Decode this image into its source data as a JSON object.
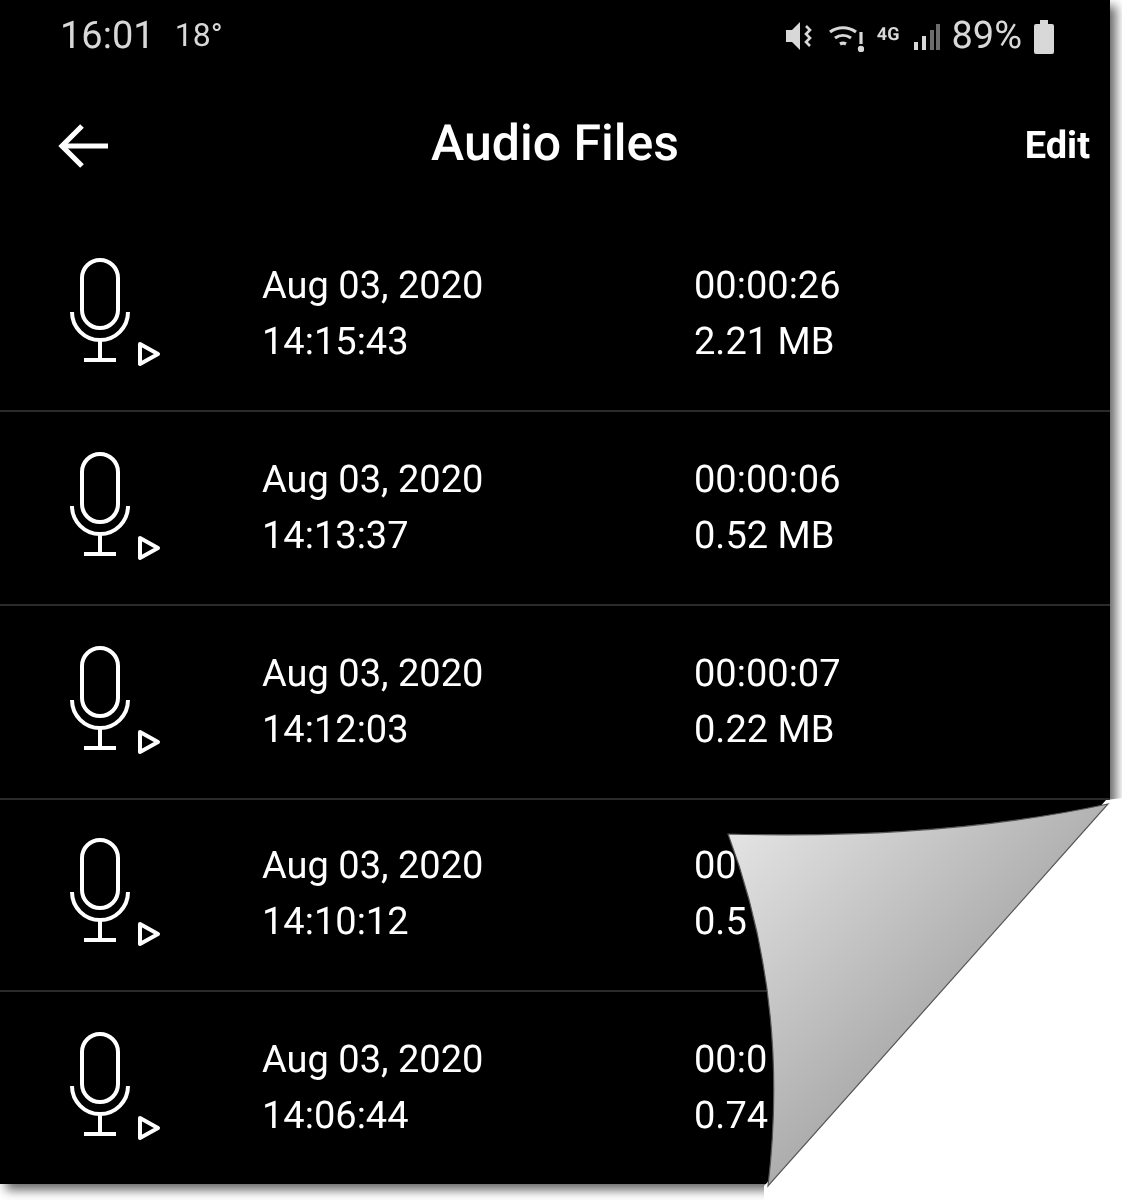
{
  "status_bar": {
    "time": "16:01",
    "temperature": "18°",
    "network": "4G",
    "battery": "89%"
  },
  "header": {
    "title": "Audio Files",
    "action": "Edit"
  },
  "recordings": [
    {
      "date": "Aug 03, 2020",
      "time": "14:15:43",
      "duration": "00:00:26",
      "size": "2.21 MB"
    },
    {
      "date": "Aug 03, 2020",
      "time": "14:13:37",
      "duration": "00:00:06",
      "size": "0.52 MB"
    },
    {
      "date": "Aug 03, 2020",
      "time": "14:12:03",
      "duration": "00:00:07",
      "size": "0.22 MB"
    },
    {
      "date": "Aug 03, 2020",
      "time": "14:10:12",
      "duration": "00",
      "size": "0.5"
    },
    {
      "date": "Aug 03, 2020",
      "time": "14:06:44",
      "duration": "00:0",
      "size": "0.74"
    }
  ]
}
